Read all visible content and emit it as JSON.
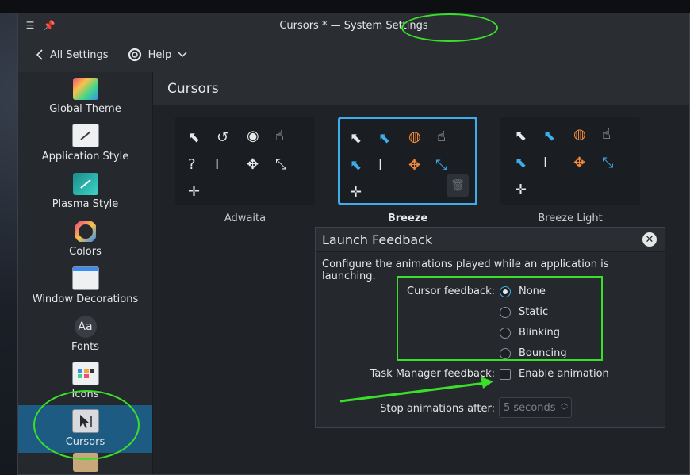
{
  "window": {
    "title": "Cursors * — System Settings"
  },
  "toolbar": {
    "all_settings_label": "All Settings",
    "help_label": "Help"
  },
  "sidebar": {
    "items": [
      {
        "label": "Global Theme",
        "icon": "global-theme-icon"
      },
      {
        "label": "Application Style",
        "icon": "application-style-icon"
      },
      {
        "label": "Plasma Style",
        "icon": "plasma-style-icon"
      },
      {
        "label": "Colors",
        "icon": "colors-icon"
      },
      {
        "label": "Window Decorations",
        "icon": "window-decorations-icon"
      },
      {
        "label": "Fonts",
        "icon": "fonts-icon"
      },
      {
        "label": "Icons",
        "icon": "icons-icon"
      },
      {
        "label": "Cursors",
        "icon": "cursors-icon"
      }
    ],
    "active": "Cursors"
  },
  "page": {
    "title": "Cursors"
  },
  "themes": [
    {
      "name": "Adwaita",
      "selected": false
    },
    {
      "name": "Breeze",
      "selected": true
    },
    {
      "name": "Breeze Light",
      "selected": false
    }
  ],
  "dialog": {
    "title": "Launch Feedback",
    "description": "Configure the animations played while an application is launching.",
    "cursor_feedback_label": "Cursor feedback:",
    "cursor_options": [
      "None",
      "Static",
      "Blinking",
      "Bouncing"
    ],
    "cursor_selected": "None",
    "task_manager_label": "Task Manager feedback:",
    "task_manager_option": "Enable animation",
    "stop_label": "Stop animations after:",
    "stop_value": "5 seconds"
  },
  "colors": {
    "accent": "#3daee9",
    "annotation": "#3adf2a",
    "active_sidebar": "#1e5b82"
  }
}
